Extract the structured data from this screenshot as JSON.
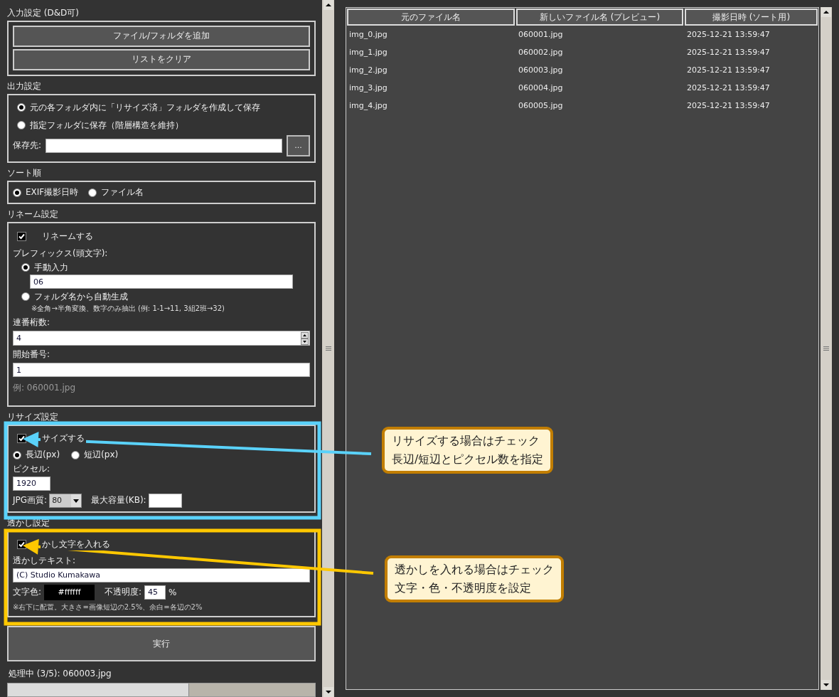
{
  "input_settings": {
    "title": "入力設定 (D&D可)",
    "buttons": [
      "ファイル/フォルダを追加",
      "リストをクリア"
    ]
  },
  "output_settings": {
    "title": "出力設定",
    "options": [
      {
        "label": "元の各フォルダ内に「リサイズ済」フォルダを作成して保存",
        "selected": true
      },
      {
        "label": "指定フォルダに保存（階層構造を維持）",
        "selected": false
      }
    ],
    "save_to": {
      "label": "保存先:"
    },
    "browse_button": "..."
  },
  "sort_order": {
    "title": "ソート順",
    "options": [
      {
        "label": "EXIF撮影日時",
        "selected": true
      },
      {
        "label": "ファイル名",
        "selected": false
      }
    ]
  },
  "rename_settings": {
    "title": "リネーム設定",
    "rename": {
      "label": "リネームする",
      "checked": true
    },
    "prefix_label": "プレフィックス(頭文字):",
    "prefix_options": [
      {
        "label": "手動入力",
        "selected": true
      },
      {
        "label": "フォルダ名から自動生成",
        "selected": false
      }
    ],
    "prefix_value": "06",
    "note": "※全角→半角変換、数字のみ抽出 (例: 1-1→11, 3組2班→32)",
    "digits": {
      "label": "連番桁数:",
      "value": "4"
    },
    "start": {
      "label": "開始番号:",
      "value": "1"
    },
    "example": "例: 060001.jpg"
  },
  "resize_settings": {
    "title": "リサイズ設定",
    "resize": {
      "label": "サイズする",
      "checked": true
    },
    "sides": [
      {
        "label": "長辺(px)",
        "selected": true
      },
      {
        "label": "短辺(px)",
        "selected": false
      }
    ],
    "pixels": {
      "label": "ピクセル:",
      "value": "1920"
    },
    "quality": {
      "label": "JPG画質:",
      "value": "80"
    },
    "max_size": {
      "label": "最大容量(KB):"
    }
  },
  "watermark_settings": {
    "title": "透かし設定",
    "enable": {
      "label": "かし文字を入れる",
      "checked": true
    },
    "text": {
      "label": "透かしテキスト:",
      "value": "(C) Studio Kumakawa"
    },
    "color": {
      "label": "文字色:",
      "value": "#ffffff"
    },
    "opacity": {
      "label": "不透明度:",
      "value": "45",
      "unit": "%"
    },
    "note": "※右下に配置。大きさ=画像短辺の2.5%、余白=各辺の2%"
  },
  "run_button": "実行",
  "status": "処理中 (3/5): 060003.jpg",
  "progress": {
    "level": 0.59
  },
  "table": {
    "columns": [
      "元のファイル名",
      "新しいファイル名 (プレビュー)",
      "撮影日時 (ソート用)"
    ],
    "rows": [
      [
        "img_0.jpg",
        "060001.jpg",
        "2025-12-21 13:59:47"
      ],
      [
        "img_1.jpg",
        "060002.jpg",
        "2025-12-21 13:59:47"
      ],
      [
        "img_2.jpg",
        "060003.jpg",
        "2025-12-21 13:59:47"
      ],
      [
        "img_3.jpg",
        "060004.jpg",
        "2025-12-21 13:59:47"
      ],
      [
        "img_4.jpg",
        "060005.jpg",
        "2025-12-21 13:59:47"
      ]
    ]
  },
  "annotations": [
    {
      "lines": [
        "リサイズする場合はチェック",
        "長辺/短辺とピクセル数を指定"
      ],
      "color": "#5ad2fa"
    },
    {
      "lines": [
        "透かしを入れる場合はチェック",
        "文字・色・不透明度を設定"
      ],
      "color": "#ffc800"
    }
  ]
}
